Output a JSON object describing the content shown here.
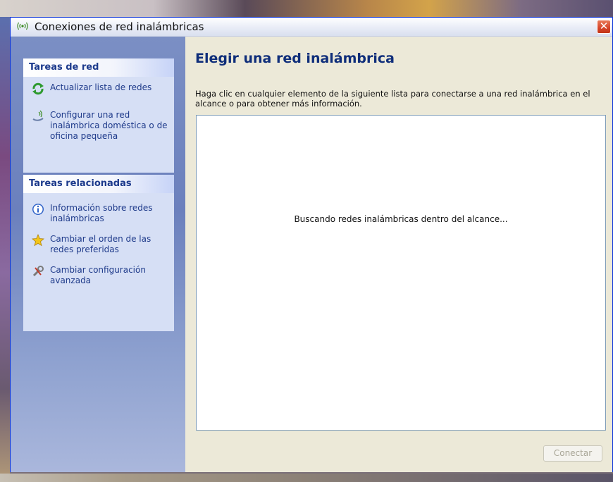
{
  "window": {
    "title": "Conexiones de red inalámbricas",
    "close_glyph": "✕"
  },
  "sidebar": {
    "groups": [
      {
        "header": "Tareas de red",
        "items": [
          {
            "label": "Actualizar lista de redes",
            "icon": "refresh-icon"
          },
          {
            "label": "Configurar una red inalámbrica doméstica o de oficina pequeña",
            "icon": "wireless-setup-icon"
          }
        ]
      },
      {
        "header": "Tareas relacionadas",
        "items": [
          {
            "label": "Información sobre redes inalámbricas",
            "icon": "info-icon"
          },
          {
            "label": "Cambiar el orden de las redes preferidas",
            "icon": "star-icon"
          },
          {
            "label": "Cambiar configuración avanzada",
            "icon": "settings-icon"
          }
        ]
      }
    ]
  },
  "main": {
    "title": "Elegir una red inalámbrica",
    "description": "Haga clic en cualquier elemento de la siguiente lista para conectarse a una red inalámbrica en el alcance o para obtener más información.",
    "status": "Buscando redes inalámbricas dentro del alcance...",
    "connect_label": "Conectar"
  },
  "colors": {
    "accent": "#0f2e7a",
    "link": "#1e3a8a",
    "close": "#d6452a"
  }
}
